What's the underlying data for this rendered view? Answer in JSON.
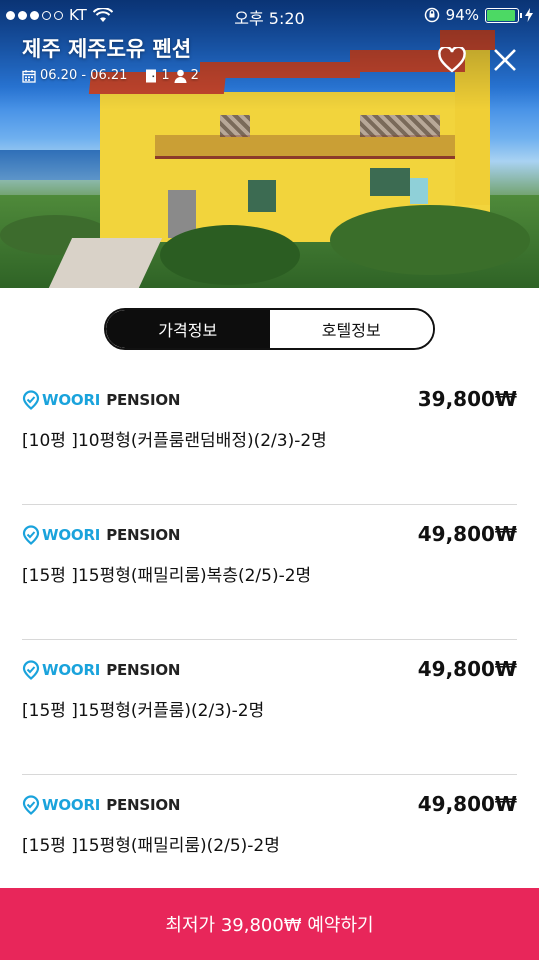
{
  "status_bar": {
    "carrier": "KT",
    "time": "오후 5:20",
    "battery_percent": "94%",
    "battery_level": 0.94,
    "signal_bars": 3
  },
  "hero": {
    "title": "제주 제주도유 펜션",
    "dates": "06.20 - 06.21",
    "rooms": "1",
    "guests": "2",
    "icons": {
      "calendar": "calendar-icon",
      "room": "door-icon",
      "guest": "person-icon",
      "favorite": "heart-icon",
      "close": "close-icon"
    }
  },
  "tabs": [
    {
      "label": "가격정보",
      "active": true
    },
    {
      "label": "호텔정보",
      "active": false
    }
  ],
  "offers": [
    {
      "brand_a": "WOORI",
      "brand_b": "PENSION",
      "price": "39,800₩",
      "room": "[10평 ]10평형(커플룸랜덤배정)(2/3)-2명"
    },
    {
      "brand_a": "WOORI",
      "brand_b": "PENSION",
      "price": "49,800₩",
      "room": "[15평 ]15평형(패밀리룸)복층(2/5)-2명"
    },
    {
      "brand_a": "WOORI",
      "brand_b": "PENSION",
      "price": "49,800₩",
      "room": "[15평 ]15평형(커플룸)(2/3)-2명"
    },
    {
      "brand_a": "WOORI",
      "brand_b": "PENSION",
      "price": "49,800₩",
      "room": "[15평 ]15평형(패밀리룸)(2/5)-2명"
    }
  ],
  "cta": {
    "label": "최저가 39,800₩ 예약하기"
  },
  "colors": {
    "accent": "#e8265a",
    "brand": "#1aa3dc",
    "tab_active": "#0d0d0d",
    "battery": "#4cd964"
  }
}
